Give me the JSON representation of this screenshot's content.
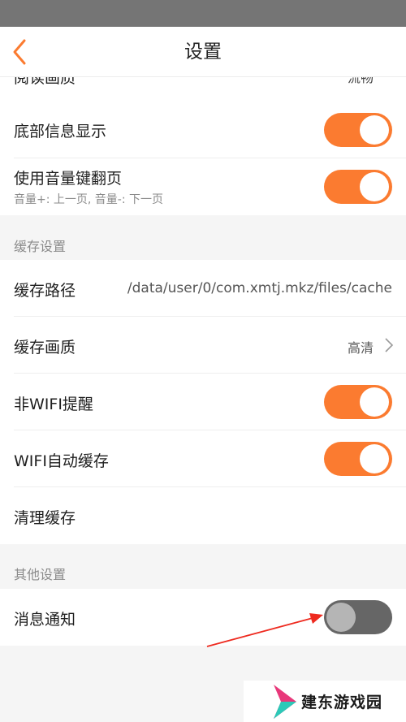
{
  "header": {
    "title": "设置"
  },
  "partial_row": {
    "label": "阅读画质",
    "value": "流畅"
  },
  "reading": {
    "bottom_info": {
      "label": "底部信息显示",
      "enabled": true
    },
    "volume_page": {
      "label": "使用音量键翻页",
      "sub": "音量+: 上一页, 音量-: 下一页",
      "enabled": true
    }
  },
  "cache_section": {
    "title": "缓存设置",
    "path": {
      "label": "缓存路径",
      "value": "/data/user/0/com.xmtj.mkz/files/cache"
    },
    "quality": {
      "label": "缓存画质",
      "value": "高清"
    },
    "non_wifi": {
      "label": "非WIFI提醒",
      "enabled": true
    },
    "wifi_auto": {
      "label": "WIFI自动缓存",
      "enabled": true
    },
    "clear": {
      "label": "清理缓存"
    }
  },
  "other_section": {
    "title": "其他设置",
    "notification": {
      "label": "消息通知",
      "enabled": false
    }
  },
  "colors": {
    "accent": "#fb7b30",
    "annotation_arrow": "#ee2a1f",
    "switch_off": "#666666"
  },
  "watermark": {
    "text": "建东游戏园"
  }
}
